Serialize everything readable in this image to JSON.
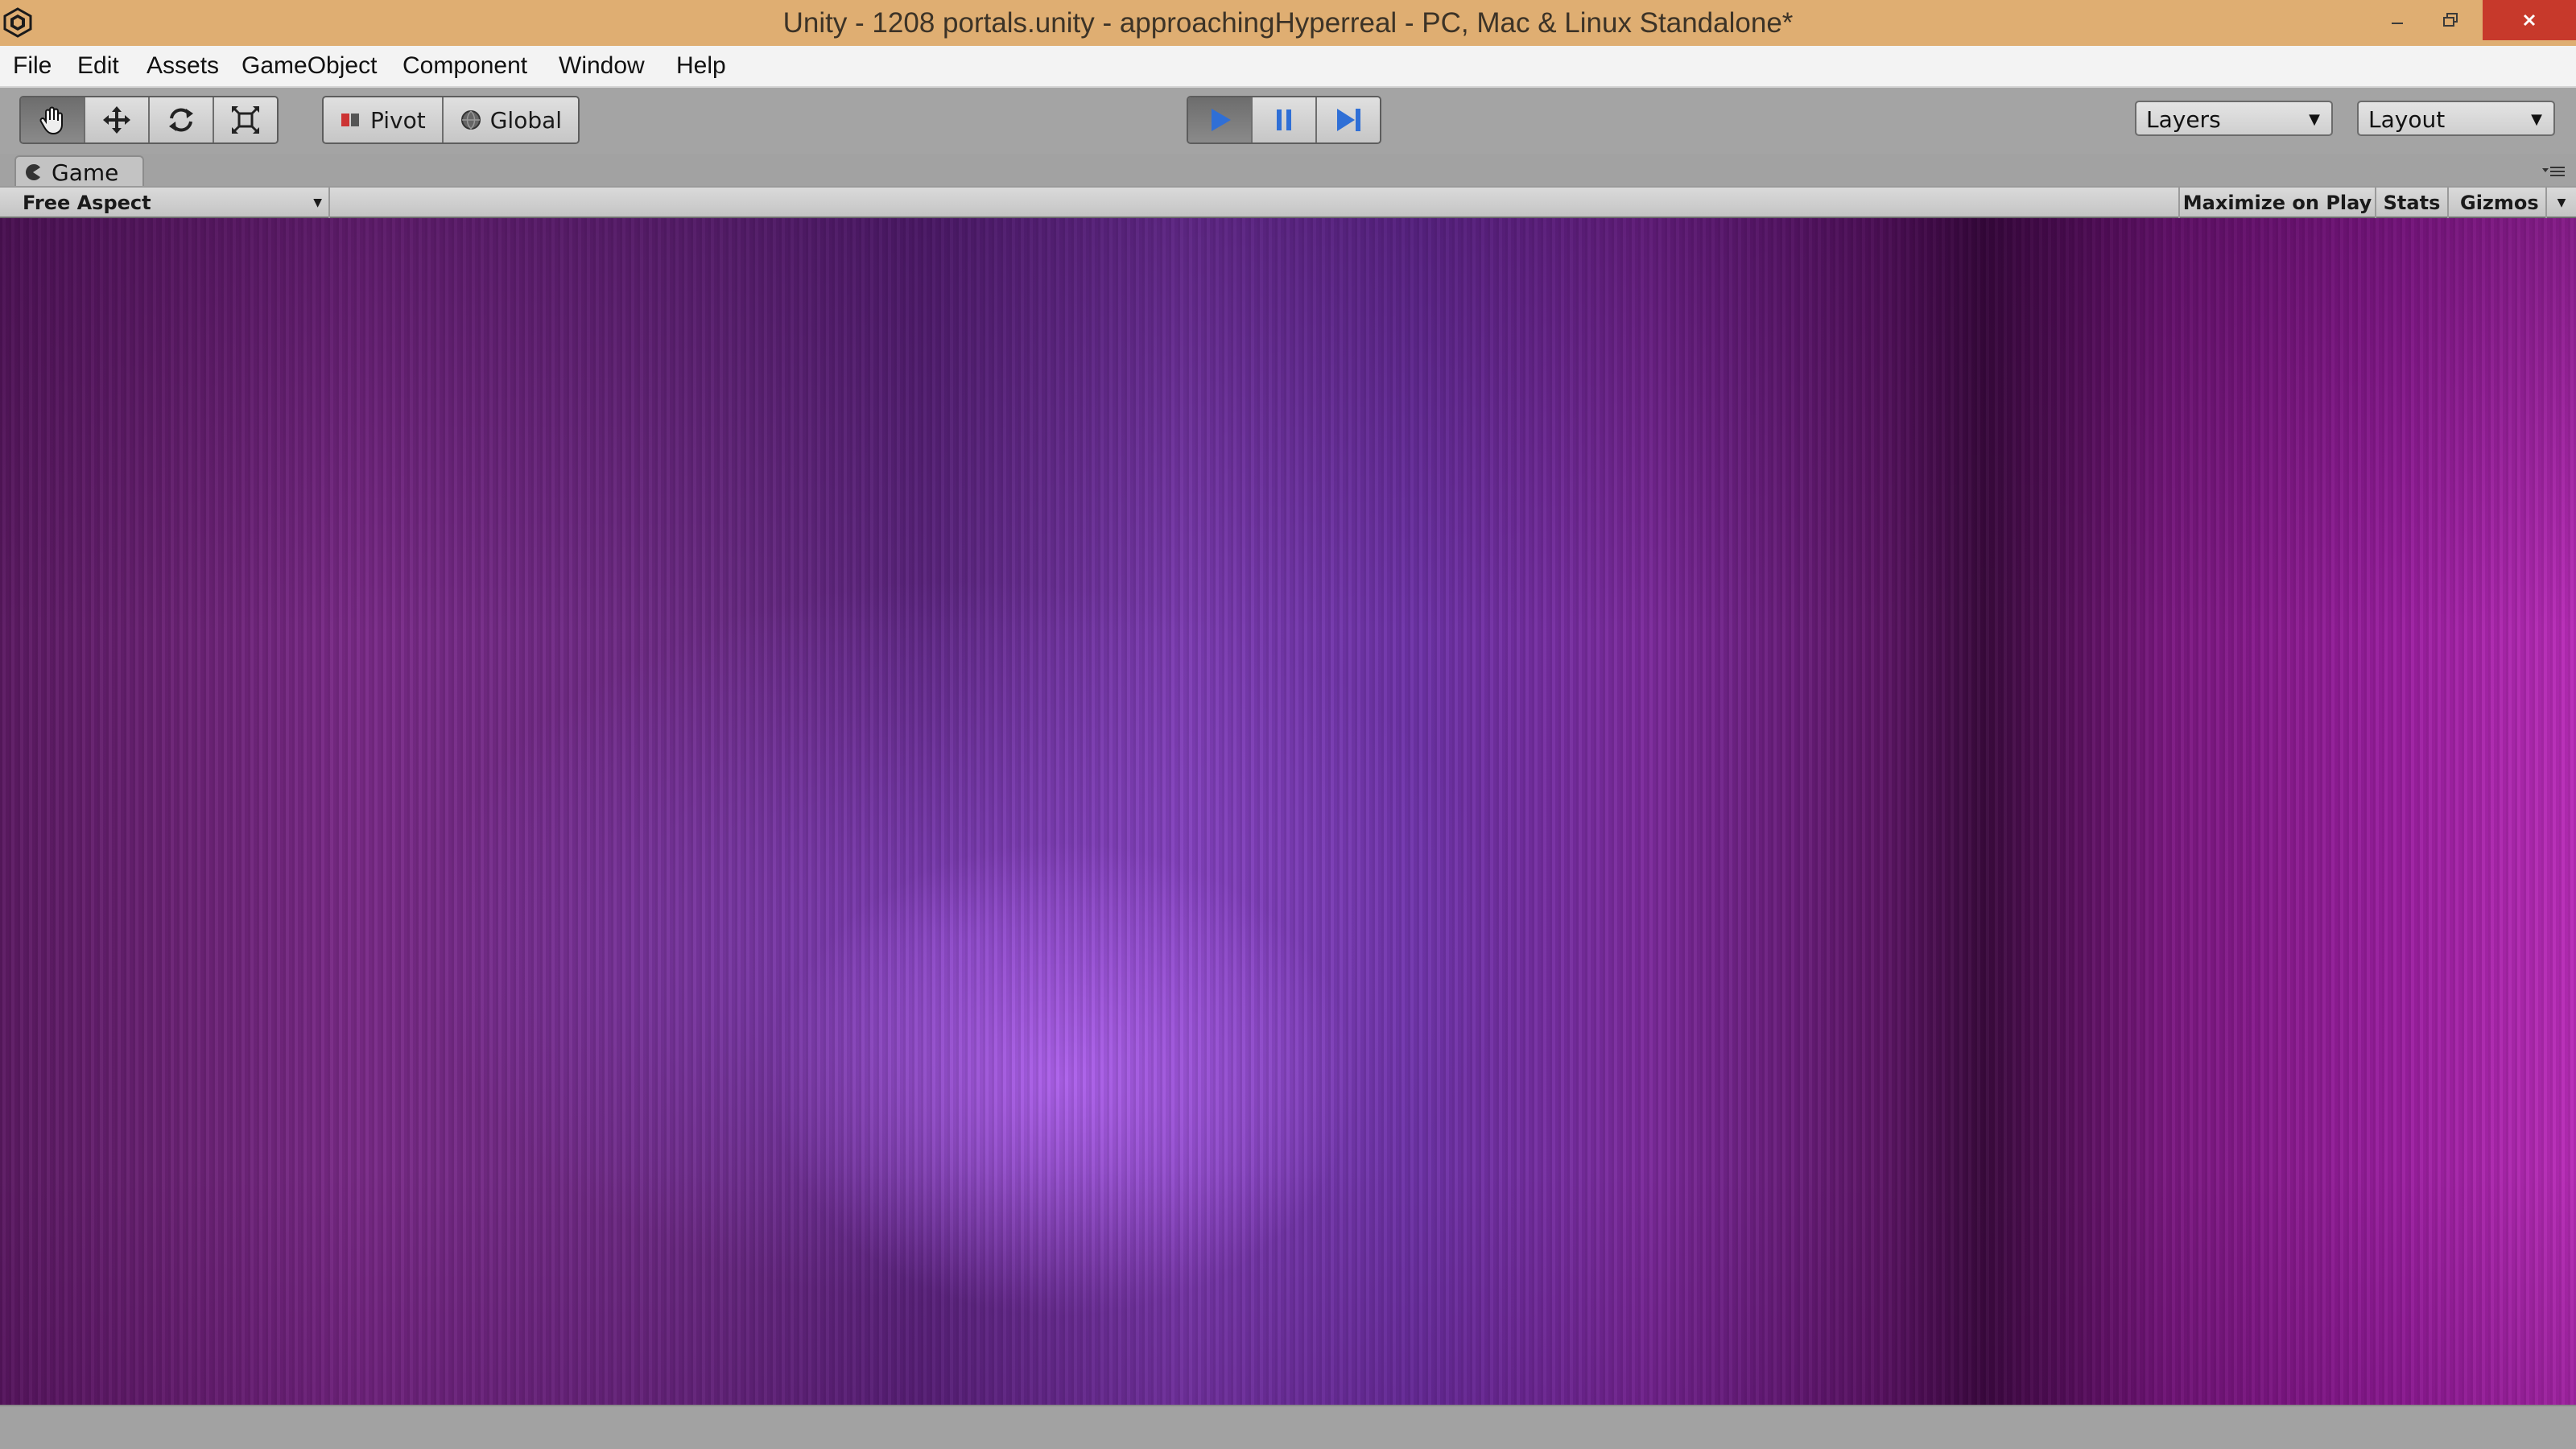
{
  "window": {
    "title": "Unity - 1208 portals.unity - approachingHyperreal - PC, Mac & Linux Standalone*",
    "minimize_icon": "minimize-icon",
    "restore_icon": "restore-icon",
    "close_icon": "close-icon"
  },
  "menu": [
    "File",
    "Edit",
    "Assets",
    "GameObject",
    "Component",
    "Window",
    "Help"
  ],
  "toolbar": {
    "tools": [
      "hand-icon",
      "move-icon",
      "rotate-icon",
      "scale-icon"
    ],
    "pivot_label": "Pivot",
    "global_label": "Global",
    "play_controls": [
      "play-icon",
      "pause-icon",
      "step-icon"
    ],
    "play_state": "playing",
    "layers_label": "Layers",
    "layout_label": "Layout"
  },
  "game_panel": {
    "tab_label": "Game",
    "aspect_label": "Free Aspect",
    "maximize_label": "Maximize on Play",
    "stats_label": "Stats",
    "gizmos_label": "Gizmos"
  },
  "colors": {
    "titlebar": "#dfae72",
    "close_button": "#c7392b",
    "play_active": "#2f6fd6",
    "game_magenta": "#b92cb8",
    "game_purple": "#7b3bb0"
  }
}
